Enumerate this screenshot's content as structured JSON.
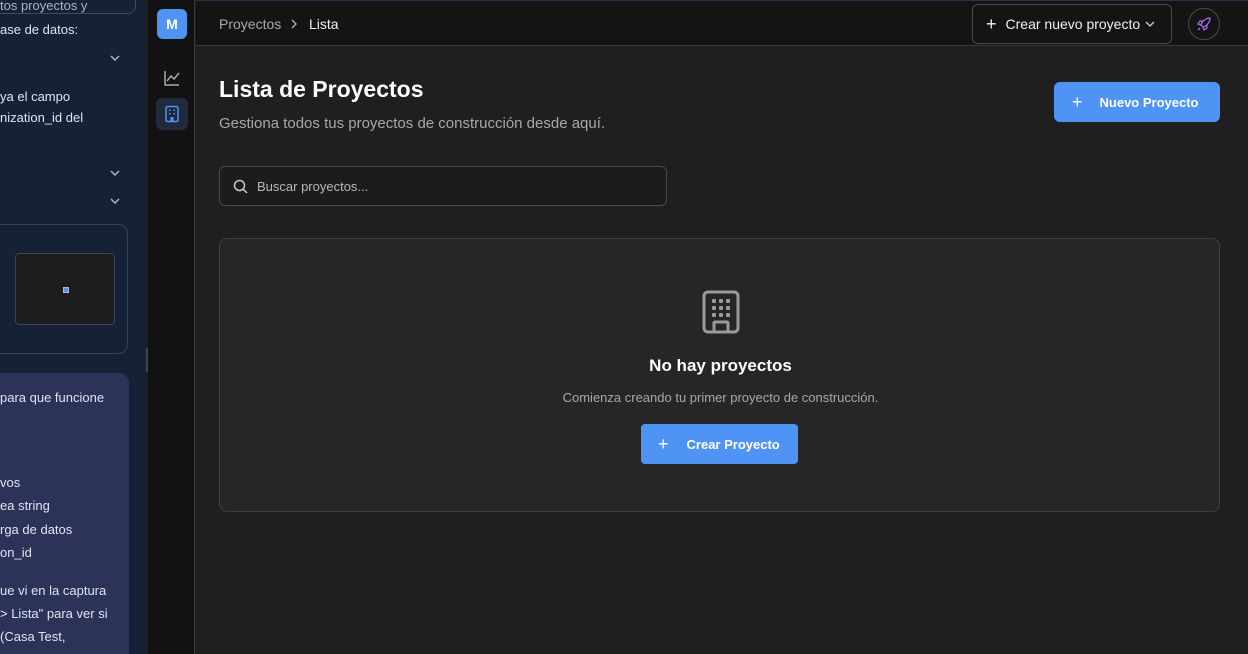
{
  "chat": {
    "lines": [
      "tos proyectos y",
      "ase de datos:",
      "ya el campo",
      "nization_id del",
      "para que funcione",
      "vos",
      "ea string",
      "rga de datos",
      "on_id",
      "ue vi en la captura",
      "> Lista\" para ver si",
      "(Casa Test,"
    ]
  },
  "rail": {
    "avatar_letter": "M"
  },
  "breadcrumb": {
    "root": "Proyectos",
    "current": "Lista"
  },
  "header": {
    "new_project_dropdown": "Crear nuevo proyecto"
  },
  "page": {
    "title": "Lista de Proyectos",
    "subtitle": "Gestiona todos tus proyectos de construcción desde aquí.",
    "new_button": "Nuevo Proyecto"
  },
  "search": {
    "placeholder": "Buscar proyectos..."
  },
  "empty_state": {
    "title": "No hay proyectos",
    "description": "Comienza creando tu primer proyecto de construcción.",
    "button": "Crear Proyecto",
    "icon": "building-icon"
  },
  "colors": {
    "accent": "#4f94f5",
    "rocket": "#a66bf0"
  }
}
